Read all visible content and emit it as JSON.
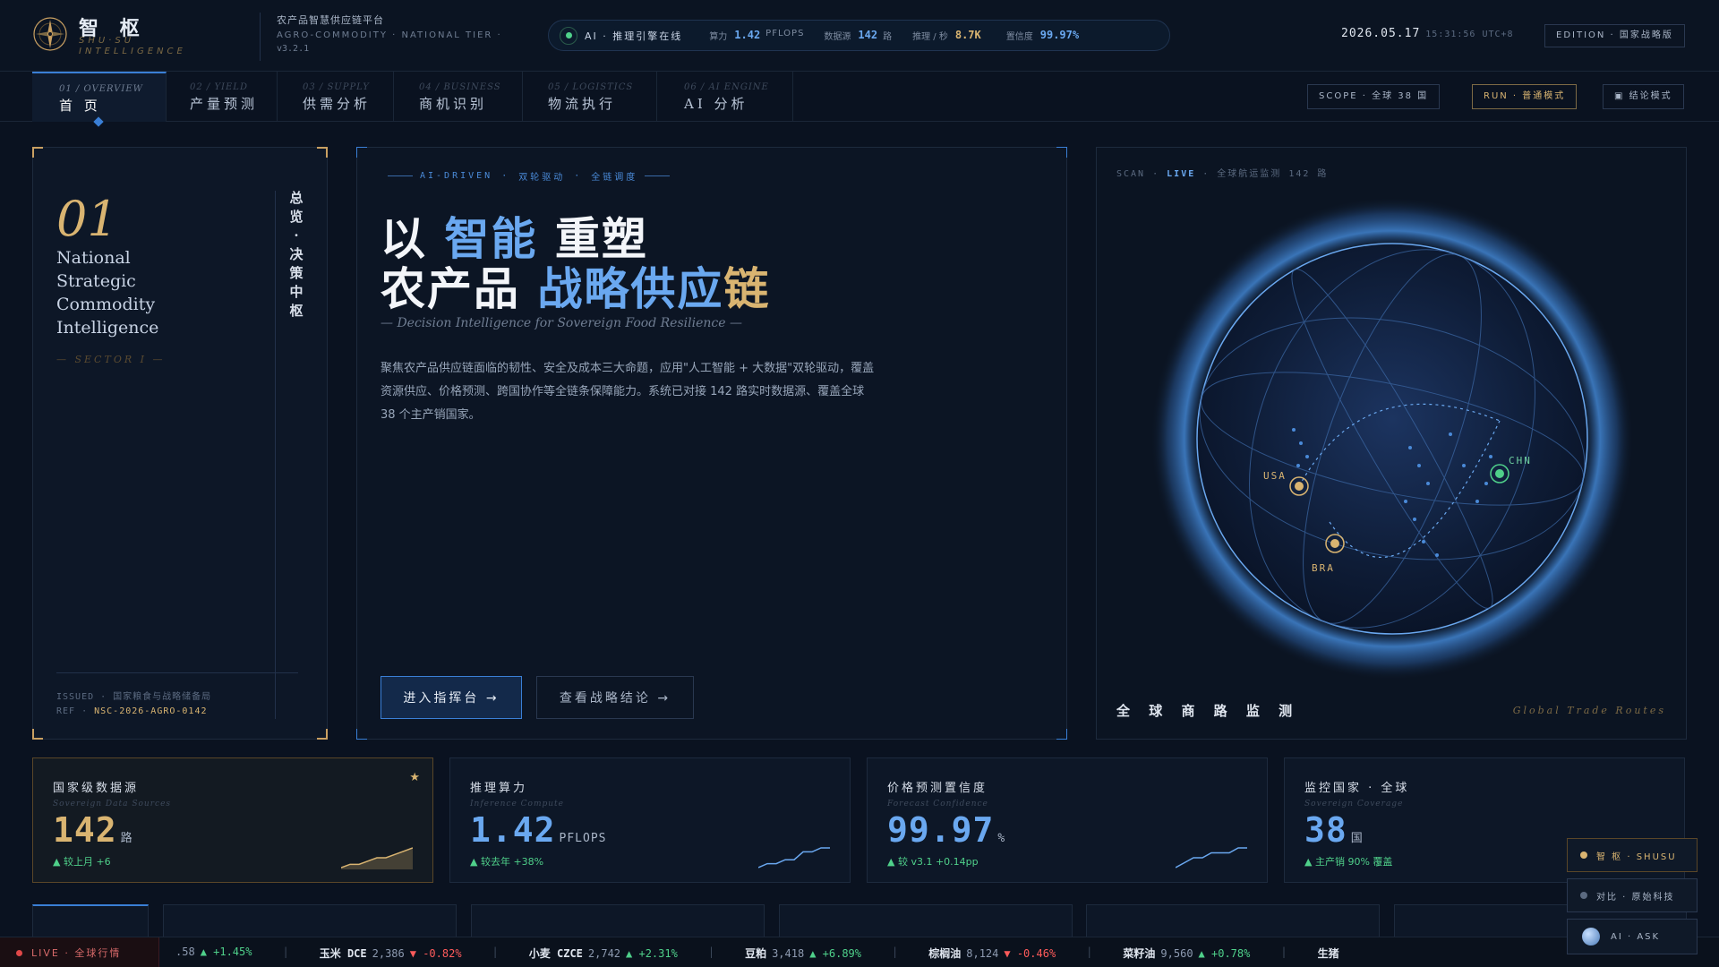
{
  "header": {
    "brand_zh": "智 枢",
    "brand_en": "SHU·SU INTELLIGENCE",
    "platform_zh": "农产品智慧供应链平台",
    "platform_en": "AGRO-COMMODITY · NATIONAL TIER ·",
    "version": "v3.2.1",
    "ai_label": "AI · 推理引擎在线",
    "metrics": [
      {
        "k": "算力",
        "v": "1.42",
        "u": "PFLOPS",
        "color": "#6aa8f0"
      },
      {
        "k": "数据源",
        "v": "142",
        "u": "路",
        "color": "#6aa8f0"
      },
      {
        "k": "推理 / 秒",
        "v": "8.7K",
        "u": "",
        "color": "#d9b471"
      },
      {
        "k": "置信度",
        "v": "99.97%",
        "u": "",
        "color": "#6aa8f0"
      }
    ],
    "date": "2026.05.17",
    "time": "15:31:56 UTC+8",
    "edition": "EDITION · 国家战略版"
  },
  "nav": {
    "tabs": [
      {
        "num": "01 / OVERVIEW",
        "label": "首  页"
      },
      {
        "num": "02 / YIELD",
        "label": "产量预测"
      },
      {
        "num": "03 / SUPPLY",
        "label": "供需分析"
      },
      {
        "num": "04 / BUSINESS",
        "label": "商机识别"
      },
      {
        "num": "05 / LOGISTICS",
        "label": "物流执行"
      },
      {
        "num": "06 / AI ENGINE",
        "label": "AI 分析"
      }
    ],
    "scope": "SCOPE · 全球 38 国",
    "run": "RUN · 普通模式",
    "conclusion": "▣ 结论模式"
  },
  "left_panel": {
    "number": "01",
    "title_lines": [
      "National",
      "Strategic",
      "Commodity",
      "Intelligence"
    ],
    "sector": "— SECTOR I —",
    "vertical": "总览·决策中枢",
    "issued": "ISSUED · 国家粮食与战略储备局",
    "ref_label": "REF · ",
    "ref": "NSC-2026-AGRO-0142"
  },
  "hero": {
    "tag1": "AI-DRIVEN",
    "tag2": "双轮驱动",
    "tag3": "全链调度",
    "h1_a1": "以 ",
    "h1_a2": "智能",
    "h1_a3": " 重塑",
    "h1_b1": "农产品 ",
    "h1_b2": "战略供应",
    "h1_b3": "链",
    "subtitle": "— Decision Intelligence for Sovereign Food Resilience —",
    "description": "聚焦农产品供应链面临的韧性、安全及成本三大命题，应用\"人工智能 + 大数据\"双轮驱动，覆盖资源供应、价格预测、跨国协作等全链条保障能力。系统已对接 142 路实时数据源、覆盖全球 38 个主产销国家。",
    "btn_primary": "进入指挥台 →",
    "btn_secondary": "查看战略结论 →"
  },
  "globe": {
    "scan_prefix": "SCAN · ",
    "scan_live": "LIVE",
    "scan_suffix": " · 全球航运监测 142 路",
    "title": "全 球 商 路 监 测",
    "subtitle": "Global Trade Routes",
    "nodes": [
      {
        "label": "USA",
        "color": "#d9b471"
      },
      {
        "label": "CHN",
        "color": "#4fd08a"
      },
      {
        "label": "BRA",
        "color": "#d9b471"
      }
    ]
  },
  "stats": [
    {
      "title": "国家级数据源",
      "sub": "Sovereign Data Sources",
      "value": "142",
      "unit": "路",
      "change": "▲ 较上月 +6",
      "color": "#d9b471",
      "spark": [
        2,
        3,
        3,
        4,
        5,
        5,
        6,
        7,
        8
      ]
    },
    {
      "title": "推理算力",
      "sub": "Inference Compute",
      "value": "1.42",
      "unit": "PFLOPS",
      "change": "▲ 较去年 +38%",
      "color": "#6aa8f0",
      "spark": [
        1,
        2,
        2,
        3,
        3,
        5,
        5,
        6,
        6
      ]
    },
    {
      "title": "价格预测置信度",
      "sub": "Forecast Confidence",
      "value": "99.97",
      "unit": "%",
      "change": "▲ 较 v3.1 +0.14pp",
      "color": "#6aa8f0",
      "spark": [
        1,
        2,
        3,
        3,
        4,
        4,
        4,
        5,
        5
      ]
    },
    {
      "title": "监控国家 · 全球",
      "sub": "Sovereign Coverage",
      "value": "38",
      "unit": "国",
      "change": "▲ 主产销 90% 覆盖",
      "color": "#6aa8f0",
      "spark": []
    }
  ],
  "ticker": {
    "live": "LIVE · 全球行情",
    "items": [
      {
        "name": "",
        "price": ".58",
        "chg": "▲ +1.45%",
        "up": true
      },
      {
        "name": "玉米 DCE",
        "price": "2,386",
        "chg": "▼ -0.82%",
        "up": false
      },
      {
        "name": "小麦 CZCE",
        "price": "2,742",
        "chg": "▲ +2.31%",
        "up": true
      },
      {
        "name": "豆粕",
        "price": "3,418",
        "chg": "▲ +6.89%",
        "up": true
      },
      {
        "name": "棕榈油",
        "price": "8,124",
        "chg": "▼ -0.46%",
        "up": false
      },
      {
        "name": "菜籽油",
        "price": "9,560",
        "chg": "▲ +0.78%",
        "up": true
      },
      {
        "name": "生猪",
        "price": "",
        "chg": "",
        "up": true
      }
    ]
  },
  "floating": {
    "btn1": "智 枢 · SHUSU",
    "btn2": "对比 · 原始科技",
    "btn3": "AI · ASK"
  }
}
